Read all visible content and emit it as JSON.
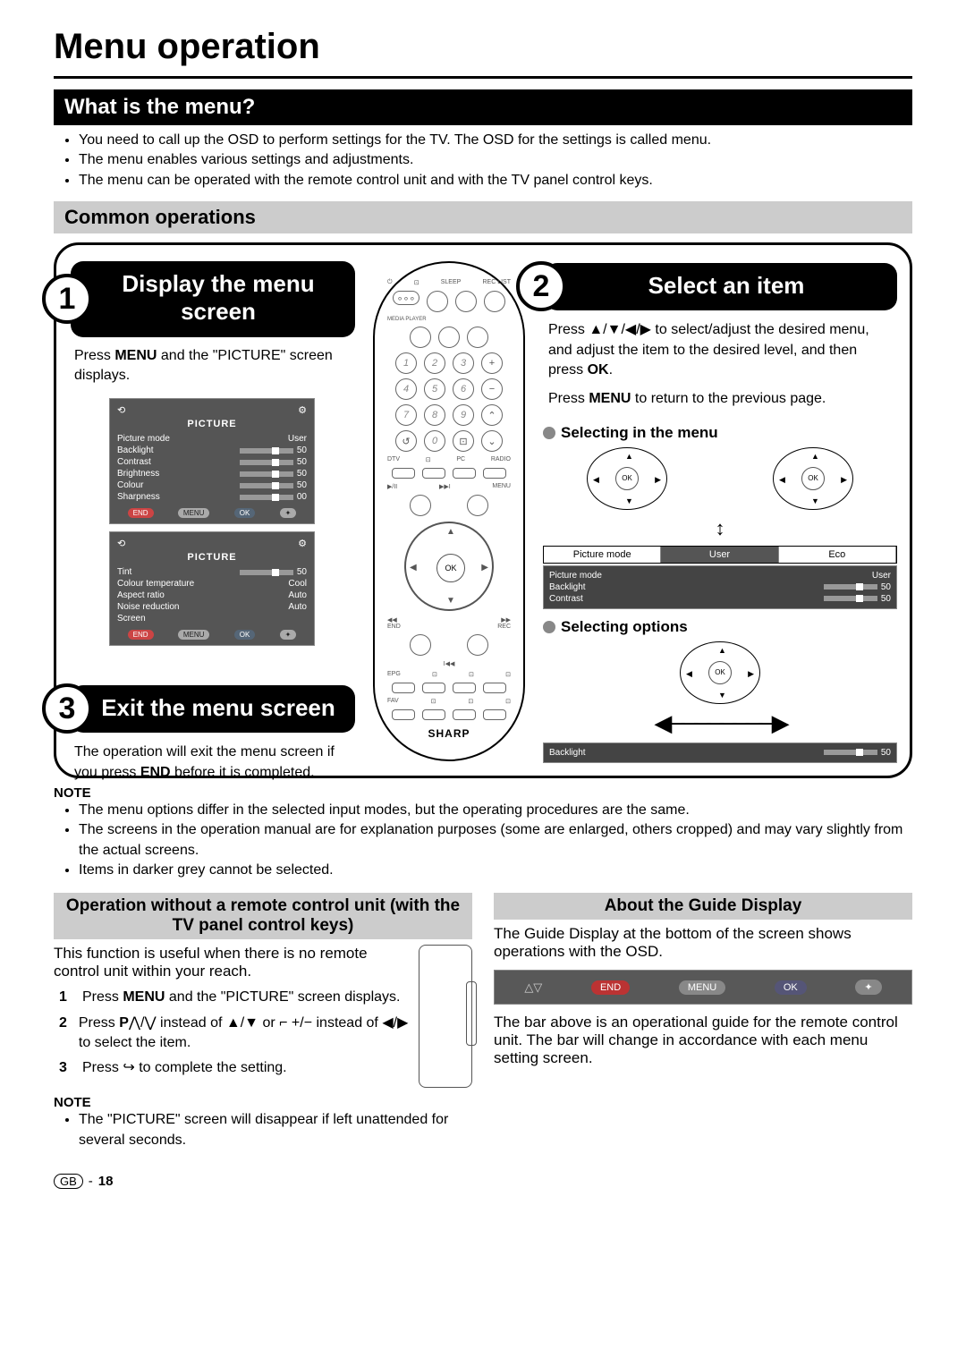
{
  "page_title": "Menu operation",
  "section_what": "What is the menu?",
  "what_bullets": [
    "You need to call up the OSD to perform settings for the TV. The OSD for the settings is called menu.",
    "The menu enables various settings and adjustments.",
    "The menu can be operated with the remote control unit and with the TV panel control keys."
  ],
  "section_common": "Common operations",
  "step1": {
    "num": "1",
    "title": "Display the menu screen",
    "body_prefix": "Press ",
    "body_bold1": "MENU",
    "body_mid": " and the \"PICTURE\" screen displays."
  },
  "picture1": {
    "title": "PICTURE",
    "rows": [
      {
        "l": "Picture mode",
        "r": "User"
      },
      {
        "l": "Backlight",
        "r": "50"
      },
      {
        "l": "Contrast",
        "r": "50"
      },
      {
        "l": "Brightness",
        "r": "50"
      },
      {
        "l": "Colour",
        "r": "50"
      },
      {
        "l": "Sharpness",
        "r": "00"
      }
    ],
    "foot": [
      "END",
      "MENU",
      "OK"
    ]
  },
  "picture2": {
    "title": "PICTURE",
    "rows": [
      {
        "l": "Tint",
        "r": "50"
      },
      {
        "l": "Colour temperature",
        "r": "Cool"
      },
      {
        "l": "Aspect ratio",
        "r": "Auto"
      },
      {
        "l": "Noise reduction",
        "r": "Auto"
      },
      {
        "l": "Screen",
        "r": ""
      }
    ],
    "foot": [
      "END",
      "MENU",
      "OK"
    ]
  },
  "step3": {
    "num": "3",
    "title": "Exit the menu screen",
    "body": "The operation will exit the menu screen if you press ",
    "bold": "END",
    "body2": " before it is completed."
  },
  "remote": {
    "top_labels": [
      "",
      "",
      "SLEEP",
      "REC LIST"
    ],
    "media": "MEDIA PLAYER",
    "nums": [
      "1",
      "2",
      "3",
      "4",
      "5",
      "6",
      "7",
      "8",
      "9",
      "0"
    ],
    "mode_labels": [
      "DTV",
      "",
      "PC",
      "RADIO"
    ],
    "play_labels": [
      "▶/II",
      "▶▶I",
      "MENU"
    ],
    "ok": "OK",
    "side": [
      "◀◀",
      "▶▶",
      "END",
      "REC",
      "I◀◀"
    ],
    "bottom_icon_row": [
      "EPG",
      "",
      "",
      ""
    ],
    "fav": "FAV",
    "brand": "SHARP"
  },
  "step2": {
    "num": "2",
    "title": "Select an item",
    "p1a": "Press ",
    "p1arrows": "▲/▼/◀/▶",
    "p1b": " to select/adjust the desired menu, and adjust the item to the desired level, and then press ",
    "p1bold": "OK",
    "p1c": ".",
    "p2a": "Press ",
    "p2bold": "MENU",
    "p2b": " to return to the previous page."
  },
  "sel_menu_title": "Selecting in the menu",
  "sel_bar": {
    "a": "Picture mode",
    "b": "User",
    "c": "Eco"
  },
  "sel_block": [
    {
      "l": "Picture mode",
      "r": "User"
    },
    {
      "l": "Backlight",
      "r": "50"
    },
    {
      "l": "Contrast",
      "r": "50"
    }
  ],
  "sel_opt_title": "Selecting options",
  "sel_opt_row": {
    "l": "Backlight",
    "r": "50"
  },
  "note_label": "NOTE",
  "note1": [
    "The menu options differ in the selected input modes, but the operating procedures are the same.",
    "The screens in the operation manual are for explanation purposes (some are enlarged, others cropped) and may vary slightly from the actual screens.",
    "Items in darker grey cannot be selected."
  ],
  "panel_title": "Operation without a remote control unit (with the TV panel control keys)",
  "panel_intro": "This function is useful when there is no remote control unit within your reach.",
  "panel_steps": [
    {
      "n": "1",
      "pre": "Press ",
      "b": "MENU",
      "post": " and the \"PICTURE\" screen displays."
    },
    {
      "n": "2",
      "pre": "Press ",
      "b": "P",
      "sym": "⋀/⋁",
      "mid": " instead of ",
      "arr1": "▲/▼",
      "mid2": " or ",
      "sym2": "⌐ +/−",
      "mid3": " instead of ",
      "arr2": "◀/▶",
      "post": " to select the item."
    },
    {
      "n": "3",
      "pre": "Press ",
      "icon": "↪",
      "post": " to complete the setting."
    }
  ],
  "note2": [
    "The \"PICTURE\" screen will disappear if left unattended for several seconds."
  ],
  "guide_title": "About the Guide Display",
  "guide_p1": "The Guide Display at the bottom of the screen shows operations with the OSD.",
  "guide_bar": {
    "tri": "△▽",
    "end": "END",
    "menu": "MENU",
    "ok": "OK"
  },
  "guide_p2": "The bar above is an operational guide for the remote control unit. The bar will change in accordance with each menu setting screen.",
  "footer": {
    "gb": "GB",
    "dash": "-",
    "page": "18"
  }
}
